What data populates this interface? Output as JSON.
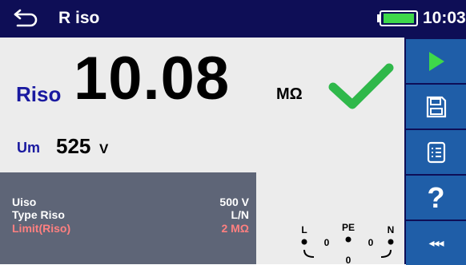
{
  "header": {
    "title": "R iso",
    "time": "10:03"
  },
  "measurement": {
    "main_label": "Riso",
    "main_value": "10.08",
    "main_unit": "MΩ",
    "um_label": "Um",
    "um_value": "525",
    "um_unit": "V"
  },
  "parameters": [
    {
      "name": "Uiso",
      "value": "500 V"
    },
    {
      "name": "Type Riso",
      "value": "L/N"
    },
    {
      "name": "Limit(Riso)",
      "value": "2 MΩ"
    }
  ],
  "terminals": {
    "l": "L",
    "pe": "PE",
    "n": "N",
    "zero": "0"
  },
  "sidebar": {
    "help_label": "?",
    "more_label": "◂◂◂"
  },
  "colors": {
    "titlebar": "#0e0e56",
    "button": "#1f5ea8",
    "accent_green": "#2fb84a",
    "label_blue": "#1a1aa0",
    "limit_red": "#ff8080"
  }
}
